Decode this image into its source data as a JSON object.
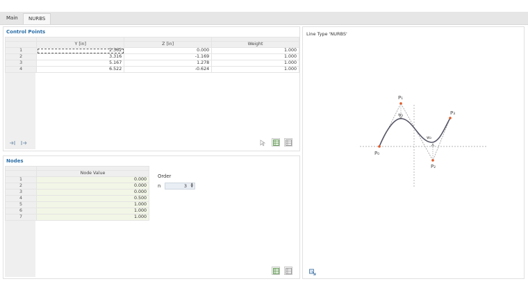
{
  "tabs": [
    {
      "label": "Main",
      "active": false
    },
    {
      "label": "NURBS",
      "active": true
    }
  ],
  "control_points": {
    "title": "Control Points",
    "columns": [
      "Y [in]",
      "Z [in]",
      "Weight"
    ],
    "rows": [
      {
        "index": "1",
        "y": "2.362",
        "z": "0.000",
        "weight": "1.000"
      },
      {
        "index": "2",
        "y": "3.316",
        "z": "-1.169",
        "weight": "1.000"
      },
      {
        "index": "3",
        "y": "5.167",
        "z": "1.278",
        "weight": "1.000"
      },
      {
        "index": "4",
        "y": "6.522",
        "z": "-0.624",
        "weight": "1.000"
      }
    ]
  },
  "nodes": {
    "title": "Nodes",
    "column": "Node Value",
    "rows": [
      {
        "index": "1",
        "value": "0.000"
      },
      {
        "index": "2",
        "value": "0.000"
      },
      {
        "index": "3",
        "value": "0.000"
      },
      {
        "index": "4",
        "value": "0.500"
      },
      {
        "index": "5",
        "value": "1.000"
      },
      {
        "index": "6",
        "value": "1.000"
      },
      {
        "index": "7",
        "value": "1.000"
      }
    ],
    "order": {
      "label": "Order",
      "n_label": "n",
      "value": "3"
    }
  },
  "graphic": {
    "title": "Line Type 'NURBS'",
    "labels": {
      "p0": "P₀",
      "p1": "P₁",
      "p2": "P₂",
      "p3": "P₃",
      "w1": "w₁",
      "w2": "w₂"
    }
  },
  "colors": {
    "accent": "#2c6fa6",
    "node_bg": "#f2f6e6",
    "point": "#e05a28",
    "curve": "#555566"
  }
}
